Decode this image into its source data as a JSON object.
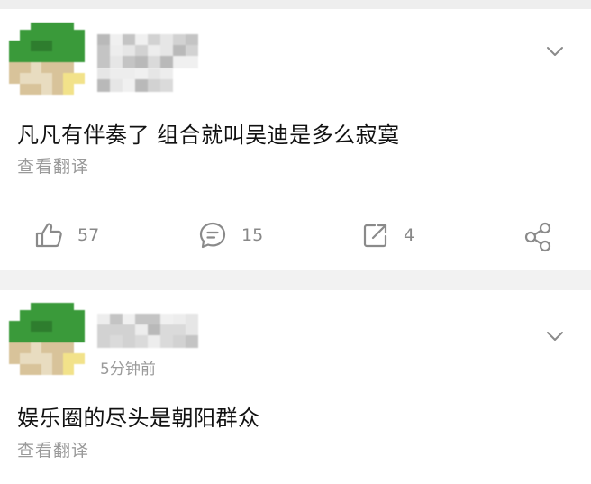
{
  "comments": [
    {
      "avatar_colors": {
        "hat": "#3a9a3a",
        "hat_dark": "#2e7d2e",
        "face": "#d8c39a",
        "face_light": "#e8dcc0",
        "accent": "#f2e28a"
      },
      "text": "凡凡有伴奏了  组合就叫吴迪是多么寂寞",
      "translate_label": "查看翻译",
      "actions": {
        "like_count": "57",
        "comment_count": "15",
        "repost_count": "4"
      },
      "icons": {
        "more": "chevron-down-icon",
        "like": "thumbs-up-icon",
        "comment": "comment-bubble-icon",
        "repost": "repost-icon",
        "share": "share-icon"
      }
    },
    {
      "avatar_colors": {
        "hat": "#3a9a3a",
        "hat_dark": "#2e7d2e",
        "face": "#d8c39a",
        "face_light": "#e8dcc0",
        "accent": "#f2e28a"
      },
      "time": "5分钟前",
      "text": "娱乐圈的尽头是朝阳群众",
      "translate_label": "查看翻译",
      "icons": {
        "more": "chevron-down-icon"
      }
    }
  ],
  "colors": {
    "background": "#f2f2f2",
    "card": "#ffffff",
    "text_primary": "#111111",
    "text_secondary": "#9a9a9a",
    "icon": "#8a8a8a"
  }
}
